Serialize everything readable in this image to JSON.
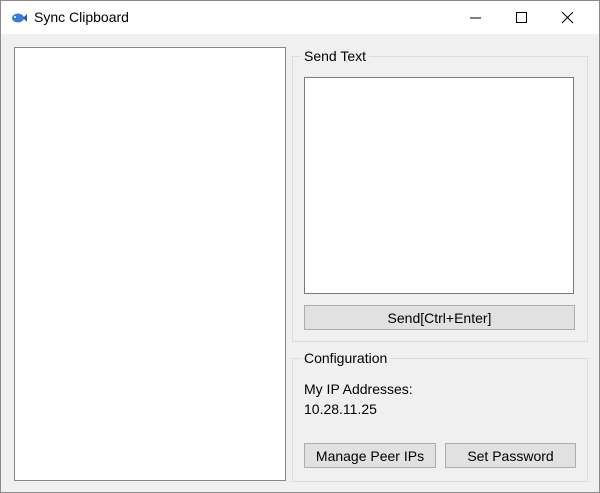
{
  "window": {
    "title": "Sync Clipboard",
    "icon": "fish-icon",
    "controls": {
      "minimize_icon": "minimize-icon",
      "maximize_icon": "maximize-icon",
      "close_icon": "close-icon"
    }
  },
  "send_text": {
    "group_label": "Send Text",
    "input_value": "",
    "send_button_label": "Send[Ctrl+Enter]"
  },
  "configuration": {
    "group_label": "Configuration",
    "ip_label": "My IP Addresses:",
    "ip_value": "10.28.11.25",
    "manage_peers_label": "Manage Peer IPs",
    "set_password_label": "Set Password"
  },
  "colors": {
    "icon_accent": "#3a7bd5",
    "window_bg": "#f0f0f0",
    "button_bg": "#e1e1e1"
  }
}
